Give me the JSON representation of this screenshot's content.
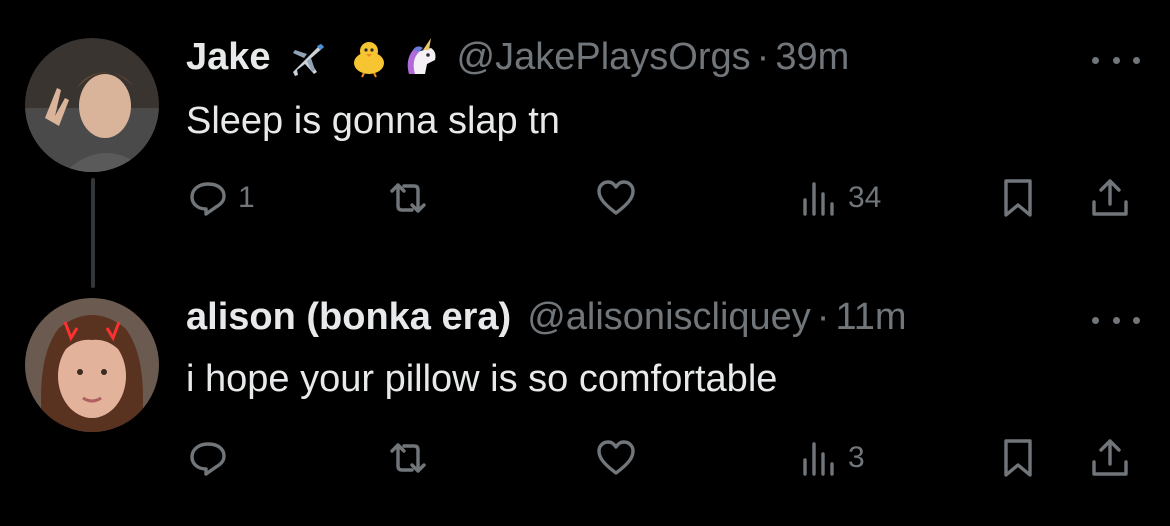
{
  "tweets": [
    {
      "name": "Jake",
      "emojis": [
        "airplane-emoji",
        "chick-emoji",
        "unicorn-emoji"
      ],
      "handle": "@JakePlaysOrgs",
      "separator": "·",
      "time": "39m",
      "text": "Sleep is gonna slap tn",
      "replies": "1",
      "retweets": "",
      "likes": "",
      "views": "34"
    },
    {
      "name": "alison (bonka era)",
      "emojis": [],
      "handle": "@alisoniscliquey",
      "separator": "·",
      "time": "11m",
      "text": "i hope your pillow is so comfortable",
      "replies": "",
      "retweets": "",
      "likes": "",
      "views": "3"
    }
  ],
  "colors": {
    "background": "#000000",
    "primary_text": "#e7e9ea",
    "secondary_text": "#71767b",
    "thread_line": "#333639"
  }
}
